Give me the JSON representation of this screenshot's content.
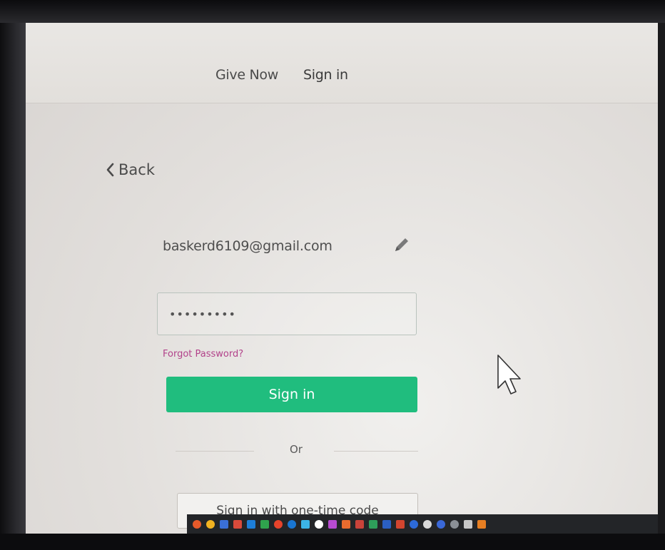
{
  "nav": {
    "give_now": "Give Now",
    "sign_in": "Sign in"
  },
  "back": {
    "label": "Back",
    "icon": "chevron-left-icon"
  },
  "account": {
    "email": "baskerd6109@gmail.com",
    "edit_icon": "pencil-icon"
  },
  "password": {
    "value": "•••••••••",
    "type": "password"
  },
  "forgot_password": "Forgot Password?",
  "sign_in_button": "Sign in",
  "divider_text": "Or",
  "one_time_code_button": "Sign in with one-time code",
  "colors": {
    "primary_button": "#20bd7e",
    "forgot_link": "#b2428a",
    "background": "#e2dfdc"
  },
  "taskbar": {
    "icons": [
      "task-icon-1",
      "task-icon-2",
      "task-icon-3",
      "task-icon-4",
      "task-icon-5",
      "task-icon-6",
      "task-icon-7",
      "task-icon-8",
      "task-icon-9",
      "task-icon-10",
      "task-icon-11",
      "task-icon-12",
      "task-icon-13",
      "task-icon-14",
      "task-icon-15",
      "task-icon-16",
      "task-icon-17",
      "task-icon-18",
      "task-icon-19",
      "task-icon-20",
      "task-icon-21",
      "task-icon-22"
    ]
  }
}
